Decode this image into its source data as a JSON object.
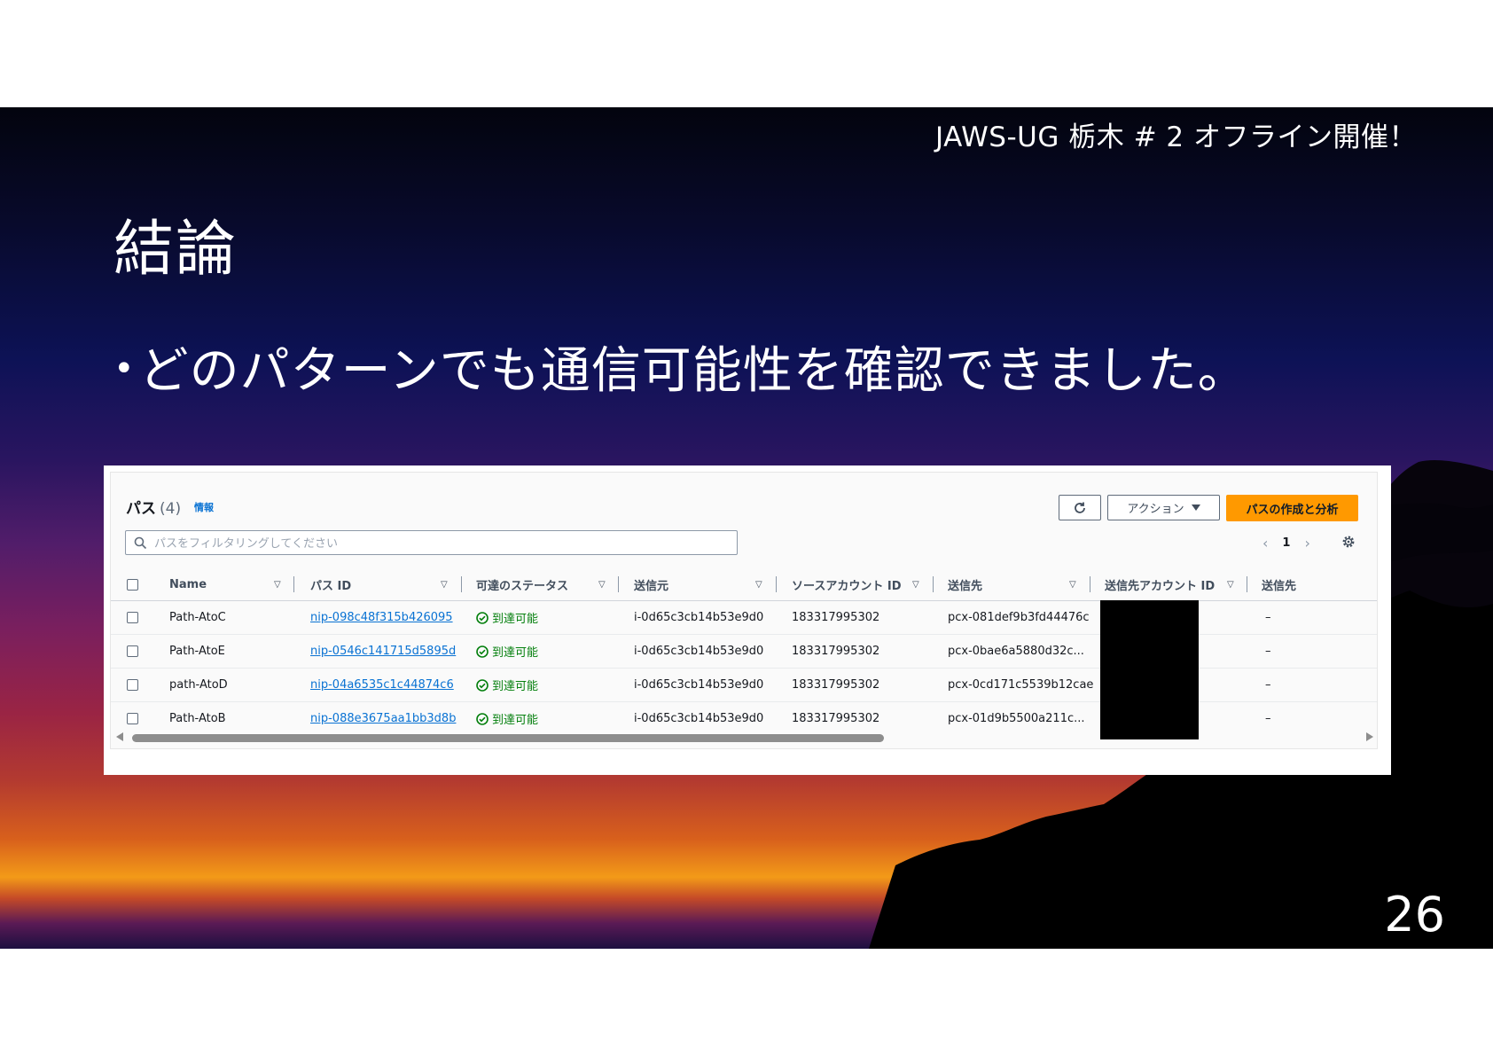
{
  "slide": {
    "event_title": "JAWS-UG 栃木 # 2 オフライン開催！",
    "title": "結論",
    "bullet": "どのパターンでも通信可能性を確認できました。",
    "page_number": "26"
  },
  "console": {
    "header": {
      "title": "パス",
      "count": "(4)",
      "info_link": "情報"
    },
    "buttons": {
      "action": "アクション",
      "create": "パスの作成と分析"
    },
    "search": {
      "placeholder": "パスをフィルタリングしてください"
    },
    "pagination": {
      "current_page": "1"
    },
    "columns": [
      "Name",
      "パス ID",
      "可達のステータス",
      "送信元",
      "ソースアカウント ID",
      "送信先",
      "送信先アカウント ID",
      "送信先"
    ],
    "rows": [
      {
        "name": "Path-AtoC",
        "path_id": "nip-098c48f315b426095",
        "status": "到達可能",
        "source": "i-0d65c3cb14b53e9d0",
        "source_account": "183317995302",
        "destination": "pcx-081def9b3fd44476c",
        "dest_extra": "–"
      },
      {
        "name": "Path-AtoE",
        "path_id": "nip-0546c141715d5895d",
        "status": "到達可能",
        "source": "i-0d65c3cb14b53e9d0",
        "source_account": "183317995302",
        "destination": "pcx-0bae6a5880d32c...",
        "dest_extra": "–"
      },
      {
        "name": "path-AtoD",
        "path_id": "nip-04a6535c1c44874c6",
        "status": "到達可能",
        "source": "i-0d65c3cb14b53e9d0",
        "source_account": "183317995302",
        "destination": "pcx-0cd171c5539b12cae",
        "dest_extra": "–"
      },
      {
        "name": "Path-AtoB",
        "path_id": "nip-088e3675aa1bb3d8b",
        "status": "到達可能",
        "source": "i-0d65c3cb14b53e9d0",
        "source_account": "183317995302",
        "destination": "pcx-01d9b5500a211c...",
        "dest_extra": "–"
      }
    ],
    "colors": {
      "accent": "#ff9900",
      "link": "#0972d3",
      "success": "#037f0c"
    }
  }
}
